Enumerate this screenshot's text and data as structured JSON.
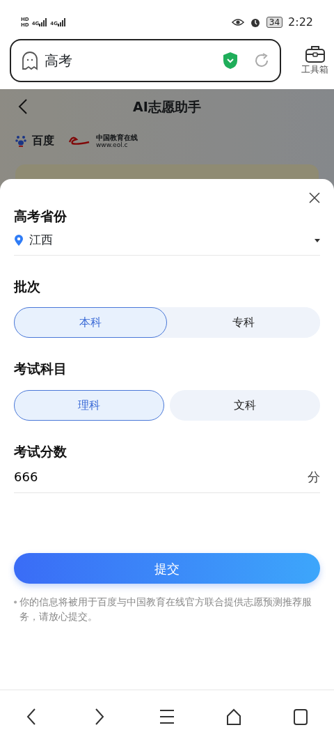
{
  "status_bar": {
    "hd": [
      "HD",
      "HD"
    ],
    "network": [
      "4G",
      "4G"
    ],
    "battery": "34",
    "time": "2:22"
  },
  "address_bar": {
    "query": "高考",
    "tools_label": "工具箱"
  },
  "page": {
    "title": "AI志愿助手",
    "logos": [
      "百度",
      "中国教育在线",
      "www.eol.c"
    ]
  },
  "form": {
    "province": {
      "label": "高考省份",
      "value": "江西"
    },
    "groups": [
      {
        "label": "批次",
        "kind": "track",
        "options": [
          {
            "label": "本科",
            "selected": true
          },
          {
            "label": "专科",
            "selected": false
          }
        ]
      },
      {
        "label": "考试科目",
        "kind": "pills",
        "options": [
          {
            "label": "理科",
            "selected": true
          },
          {
            "label": "文科",
            "selected": false
          }
        ]
      }
    ],
    "score": {
      "label": "考试分数",
      "value": "666",
      "unit": "分"
    },
    "submit": "提交",
    "note": "你的信息将被用于百度与中国教育在线官方联合提供志愿预测推荐服务，请放心提交。"
  }
}
